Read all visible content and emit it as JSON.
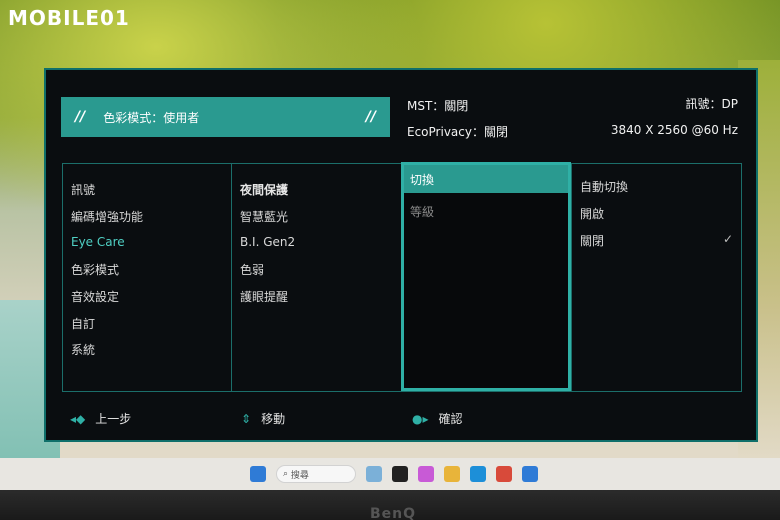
{
  "watermark": "MOBILE01",
  "osd": {
    "mode_label": "色彩模式：使用者",
    "mode_slash_left": "//",
    "mode_slash_right": "//",
    "mst": "MST：關閉",
    "ecoprivacy": "EcoPrivacy：關閉",
    "signal": "訊號：DP",
    "resolution": "3840 X 2560 @60 Hz",
    "main_menu": [
      "訊號",
      "編碼增強功能",
      "Eye Care",
      "色彩模式",
      "音效設定",
      "自訂",
      "系統"
    ],
    "sub_menu_title": "夜間保護",
    "sub_menu": [
      "智慧藍光",
      "B.I. Gen2",
      "色弱",
      "護眼提醒"
    ],
    "option_menu": [
      "切換",
      "等級"
    ],
    "value_menu": [
      "自動切換",
      "開啟",
      "關閉"
    ],
    "footer": {
      "back_label": "上一步",
      "move_label": "移動",
      "confirm_label": "確認"
    }
  },
  "taskbar": {
    "search_placeholder": "搜尋"
  },
  "monitor_brand": "BenQ",
  "colors": {
    "accent": "#2a9a90",
    "active_text": "#4fd0c4",
    "panel_bg": "#0a0d10"
  }
}
